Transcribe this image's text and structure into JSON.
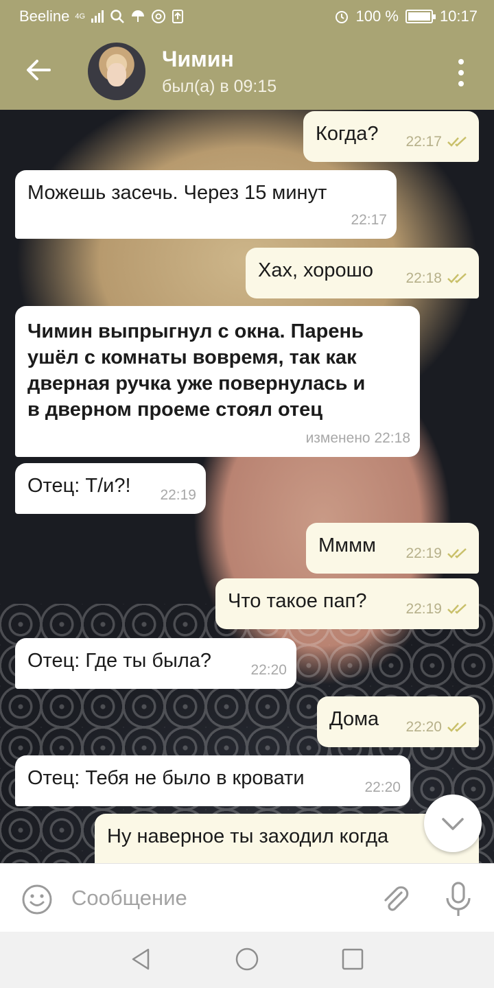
{
  "status_bar": {
    "carrier": "Beeline",
    "network": "4G",
    "battery": "100 %",
    "battery_level": 1.0,
    "time": "10:17"
  },
  "header": {
    "contact_name": "Чимин",
    "last_seen": "был(а) в 09:15"
  },
  "messages": [
    {
      "text": "Когда?",
      "time": "22:17"
    },
    {
      "text": "Можешь засечь. Через 15 минут",
      "time": "22:17"
    },
    {
      "text": "Хах, хорошо",
      "time": "22:18"
    },
    {
      "lines": [
        "Чимин выпрыгнул с окна. Парень",
        "ушёл с комнаты вовремя, так как",
        "дверная ручка уже повернулась и",
        "в дверном проеме стоял отец"
      ],
      "time": "изменено 22:18"
    },
    {
      "text": "Отец: Т/и?!",
      "time": "22:19"
    },
    {
      "text": "Мммм",
      "time": "22:19"
    },
    {
      "text": "Что такое пап?",
      "time": "22:19"
    },
    {
      "text": "Отец: Где ты была?",
      "time": "22:20"
    },
    {
      "text": "Дома",
      "time": "22:20"
    },
    {
      "text": "Отец: Тебя не было в кровати",
      "time": "22:20"
    },
    {
      "text": "Ну наверное ты заходил когда"
    }
  ],
  "input": {
    "placeholder": "Сообщение"
  },
  "icons": {
    "back": "arrow-left-icon",
    "menu": "more-vertical-icon",
    "emoji": "emoji-icon",
    "attach": "paperclip-icon",
    "mic": "microphone-icon",
    "scroll_down": "chevron-down-icon"
  },
  "colors": {
    "header": "#a9a474",
    "outgoing_bubble": "#fbf8e6",
    "incoming_bubble": "#ffffff",
    "read_ticks": "#c9c06a"
  }
}
